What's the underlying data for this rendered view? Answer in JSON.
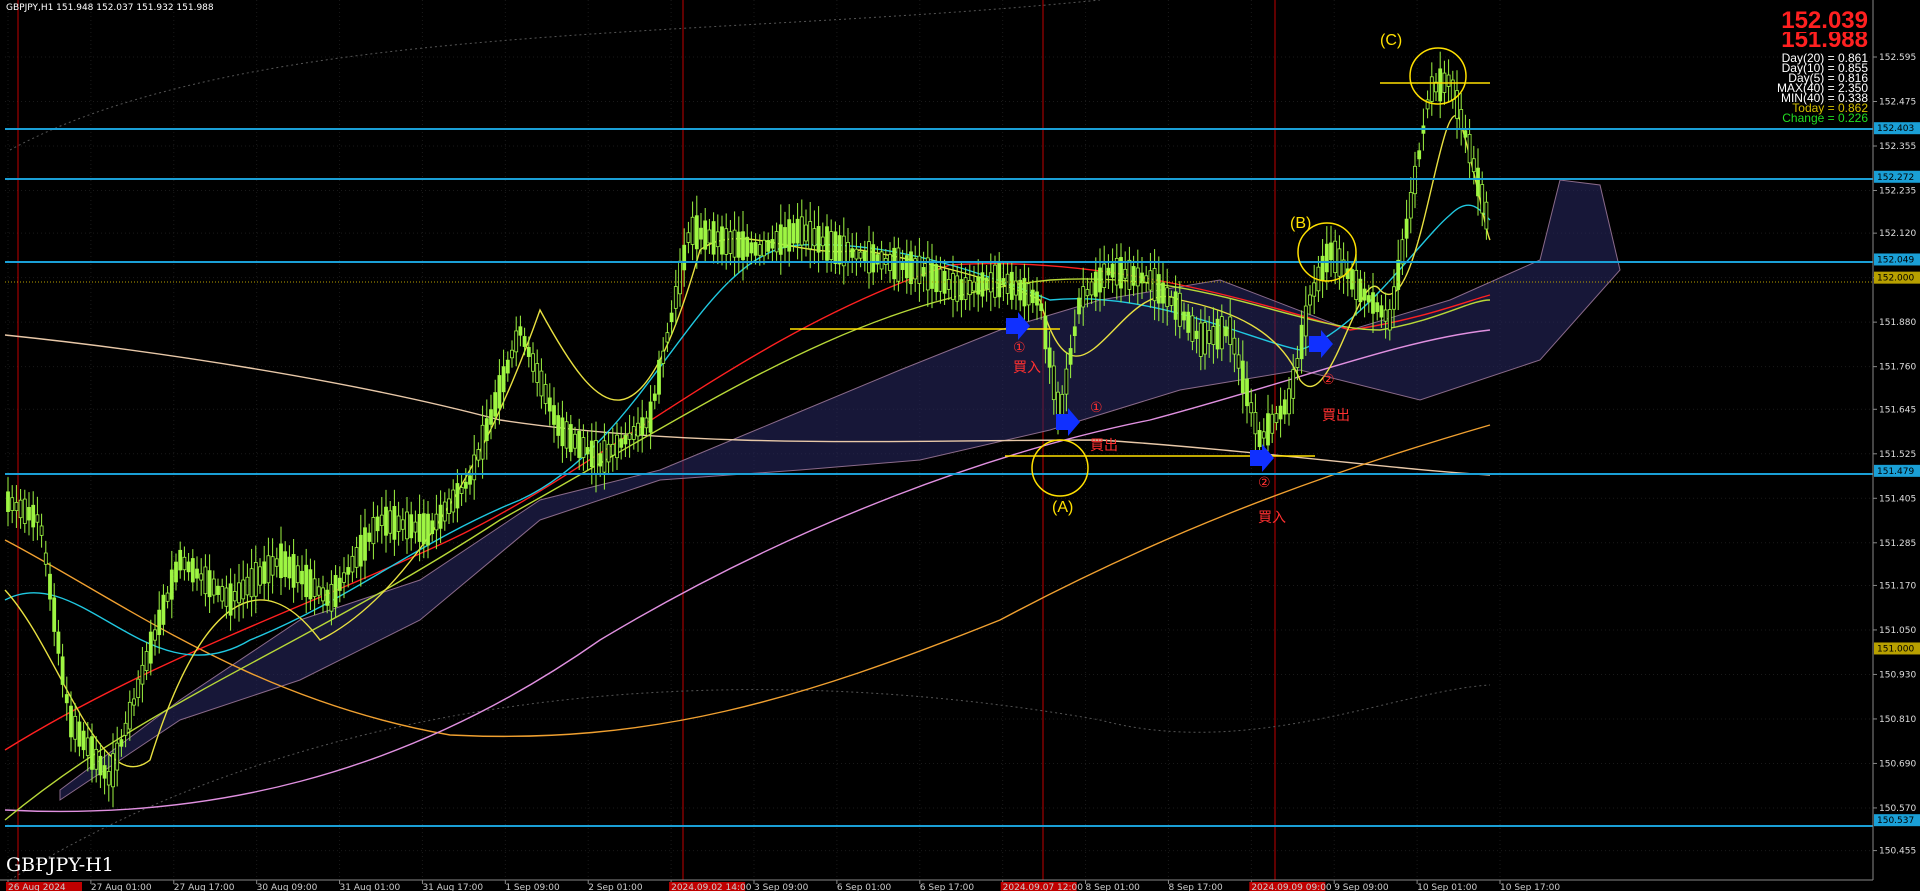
{
  "window": {
    "ohlc_header": "GBPJPY,H1  151.948 152.037 151.932 151.988",
    "watermark": "GBPJPY-H1"
  },
  "quote": {
    "bid": "152.039",
    "ask": "151.988",
    "stats": [
      {
        "text": "Day(20) = 0.861",
        "color": "#ffffff"
      },
      {
        "text": "Day(10) = 0.855",
        "color": "#ffffff"
      },
      {
        "text": "Day(5) = 0.816",
        "color": "#ffffff"
      },
      {
        "text": "MAX(40) = 2.350",
        "color": "#ffffff"
      },
      {
        "text": "MIN(40) = 0.338",
        "color": "#ffffff"
      },
      {
        "text": "Today = 0.862",
        "color": "#d4c000"
      },
      {
        "text": "Change = 0.226",
        "color": "#22dd22"
      }
    ]
  },
  "price_axis": {
    "ticks": [
      "152.595",
      "152.475",
      "152.355",
      "152.235",
      "152.120",
      "152.000",
      "151.880",
      "151.760",
      "151.645",
      "151.525",
      "151.405",
      "151.285",
      "151.170",
      "151.050",
      "150.930",
      "150.810",
      "150.690",
      "150.570",
      "150.455"
    ],
    "highlighted_levels": [
      {
        "label": "152.403",
        "bg": "#1a9fd6",
        "fg": "#000000"
      },
      {
        "label": "152.272",
        "bg": "#1a9fd6",
        "fg": "#000000"
      },
      {
        "label": "152.049",
        "bg": "#1a9fd6",
        "fg": "#000000"
      },
      {
        "label": "152.000",
        "bg": "#b8a000",
        "fg": "#000000"
      },
      {
        "label": "151.479",
        "bg": "#1a9fd6",
        "fg": "#000000"
      },
      {
        "label": "151.000",
        "bg": "#b8a000",
        "fg": "#000000"
      },
      {
        "label": "150.537",
        "bg": "#1a9fd6",
        "fg": "#000000"
      }
    ]
  },
  "time_axis": {
    "labels": [
      "26 Aug 2024",
      "27 Aug 01:00",
      "27 Aug 17:00",
      "30 Aug 09:00",
      "31 Aug 01:00",
      "31 Aug 17:00",
      "1 Sep 09:00",
      "2 Sep 01:00",
      "2024.09.02 14:00",
      "3 Sep 09:00",
      "6 Sep 01:00",
      "6 Sep 17:00",
      "2024.09.07 12:00",
      "8 Sep 01:00",
      "8 Sep 17:00",
      "2024.09.09 09:00",
      "9 Sep 09:00",
      "10 Sep 01:00",
      "10 Sep 17:00"
    ],
    "highlighted": [
      "26 Aug 2024",
      "2024.09.02 14:00",
      "2024.09.07 12:00",
      "2024.09.09 09:00"
    ]
  },
  "annotations": {
    "circle_a": "(A)",
    "circle_b": "(B)",
    "circle_c": "(C)",
    "buy1_top": "①",
    "buy1_text": "買入",
    "buy1b_top": "①",
    "buy1b_text": "買出",
    "buy2_top": "②",
    "buy2_text": "買入",
    "sell_top": "②",
    "sell_text": "買出"
  },
  "colors": {
    "background": "#000000",
    "bull_candle": "#9ef542",
    "hline": "#1a9fd6",
    "session_line": "#c00000",
    "annotation": "#ffe000",
    "arrow": "#1030ff"
  }
}
